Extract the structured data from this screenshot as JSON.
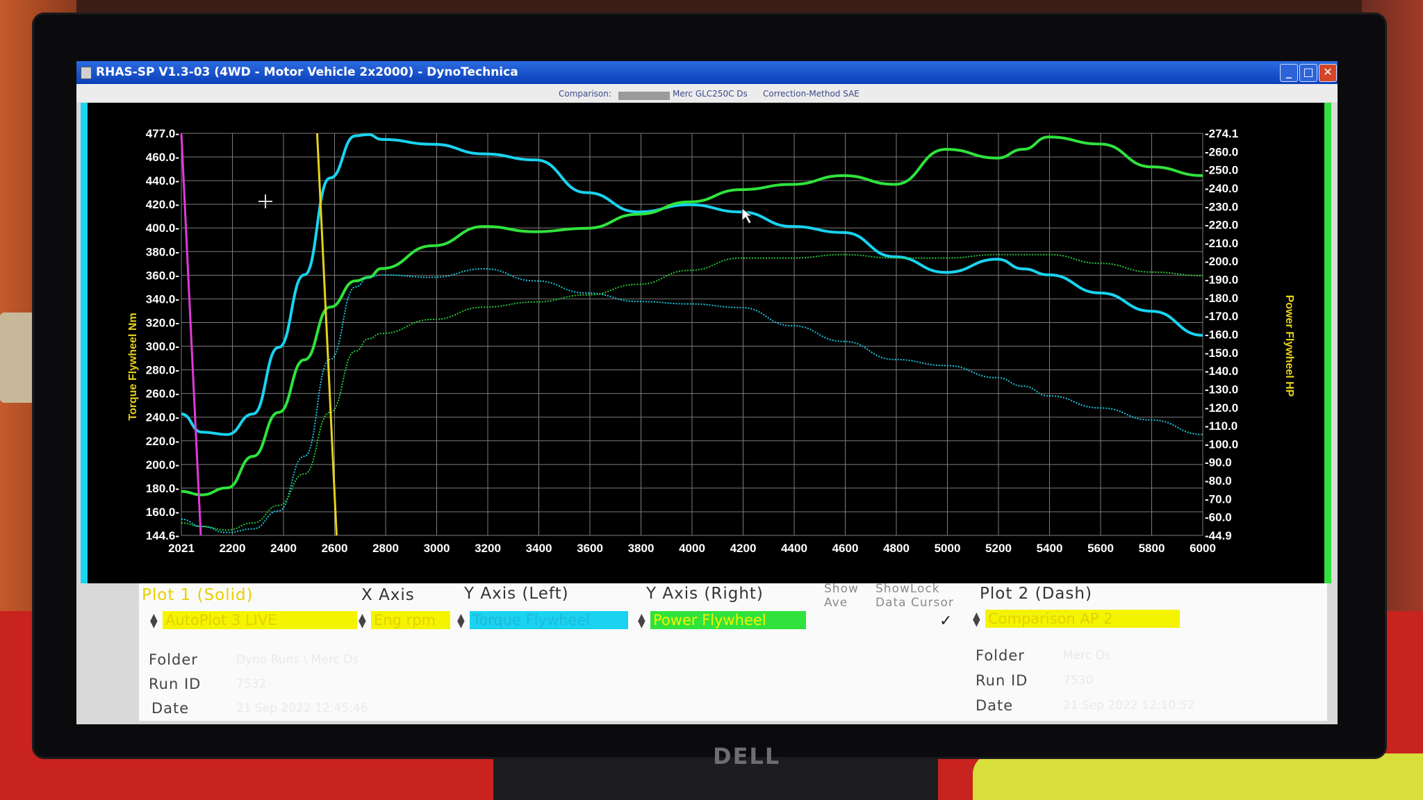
{
  "window": {
    "title": "RHAS-SP V1.3-03  (4WD - Motor Vehicle 2x2000) - DynoTechnica",
    "controls": [
      "_",
      "□",
      "✕"
    ]
  },
  "subheader": {
    "comparison_label": "Comparison:",
    "vehicle": "Merc GLC250C Ds",
    "correction": "Correction-Method  SAE"
  },
  "chart_data": {
    "type": "line",
    "x": [
      2021,
      2100,
      2200,
      2300,
      2400,
      2500,
      2600,
      2700,
      2750,
      2800,
      3000,
      3200,
      3400,
      3600,
      3800,
      4000,
      4200,
      4400,
      4600,
      4800,
      5000,
      5200,
      5300,
      5400,
      5600,
      5800,
      6000
    ],
    "x_ticks": [
      "2021",
      "2200",
      "2400",
      "2600",
      "2800",
      "3000",
      "3200",
      "3400",
      "3600",
      "3800",
      "4000",
      "4200",
      "4400",
      "4600",
      "4800",
      "5000",
      "5200",
      "5400",
      "5600",
      "5800",
      "6000"
    ],
    "y_left_ticks": [
      "477.0-",
      "460.0-",
      "440.0-",
      "420.0-",
      "400.0-",
      "380.0-",
      "360.0-",
      "340.0-",
      "320.0-",
      "300.0-",
      "280.0-",
      "260.0-",
      "240.0-",
      "220.0-",
      "200.0-",
      "180.0-",
      "160.0-",
      "144.6-"
    ],
    "y_right_ticks": [
      "-274.1",
      "-260.0",
      "-250.0",
      "-240.0",
      "-230.0",
      "-220.0",
      "-210.0",
      "-200.0",
      "-190.0",
      "-180.0",
      "-170.0",
      "-160.0",
      "-150.0",
      "-140.0",
      "-130.0",
      "-120.0",
      "-110.0",
      "-100.0",
      "-90.0",
      "-80.0",
      "-70.0",
      "-60.0",
      "-44.9"
    ],
    "ylabel_left": "Torque Flywheel Nm",
    "ylabel_right": "Power Flywheel HP",
    "ylim_left": [
      144.6,
      477.0
    ],
    "ylim_right": [
      44.9,
      274.1
    ],
    "xlim": [
      2021,
      6000
    ],
    "grid": true,
    "series": [
      {
        "name": "Torque Flywheel",
        "style": "solid",
        "axis": "left",
        "color": "#19d3f0",
        "values": [
          245,
          230,
          228,
          245,
          300,
          360,
          440,
          475,
          476,
          472,
          468,
          460,
          455,
          428,
          412,
          418,
          412,
          400,
          395,
          375,
          362,
          373,
          365,
          360,
          345,
          330,
          310
        ]
      },
      {
        "name": "Power Flywheel",
        "style": "solid",
        "axis": "right",
        "color": "#2fe33c",
        "values": [
          70,
          68,
          72,
          90,
          115,
          145,
          175,
          190,
          192,
          197,
          210,
          221,
          218,
          220,
          228,
          235,
          242,
          245,
          250,
          245,
          265,
          260,
          265,
          272,
          268,
          255,
          250
        ]
      },
      {
        "name": "Torque Flywheel",
        "style": "dash",
        "axis": "left",
        "color": "#19c6e0",
        "values": [
          158,
          152,
          147,
          150,
          165,
          210,
          290,
          350,
          358,
          360,
          358,
          365,
          355,
          345,
          338,
          336,
          333,
          318,
          305,
          290,
          285,
          275,
          268,
          260,
          250,
          240,
          228
        ]
      },
      {
        "name": "Power Flywheel",
        "style": "dash",
        "axis": "right",
        "color": "#26c936",
        "values": [
          52,
          50,
          48,
          52,
          62,
          80,
          115,
          150,
          157,
          160,
          168,
          175,
          178,
          182,
          188,
          196,
          203,
          203,
          205,
          203,
          203,
          205,
          205,
          205,
          200,
          195,
          193
        ]
      }
    ],
    "markers": [
      {
        "x": 2021,
        "color": "#e23ad8"
      },
      {
        "x": 2550,
        "color": "#e6d21a"
      }
    ],
    "cursor_at": [
      2200,
      410
    ]
  },
  "panel": {
    "plot1": {
      "label": "Plot 1 (Solid)",
      "value": "AutoPlot 3 LIVE",
      "color": "#f4f400"
    },
    "x_axis": {
      "label": "X Axis",
      "value": "Eng rpm",
      "color": "#f4f400"
    },
    "y_left": {
      "label": "Y Axis (Left)",
      "value": "Torque Flywheel",
      "color": "#19d3f0"
    },
    "y_right": {
      "label": "Y Axis (Right)",
      "value": "Power Flywheel",
      "color": "#2fe33c"
    },
    "show": {
      "line1": "Show",
      "line2": "Ave"
    },
    "showlock": {
      "line1": "ShowLock",
      "line2": "Data Cursor"
    },
    "check": "✓",
    "plot2": {
      "label": "Plot 2 (Dash)",
      "value": "Comparison AP 2",
      "color": "#f4f400"
    },
    "left_fields": {
      "folder_label": "Folder",
      "folder_value": "Dyno Runs \\ Merc Ds",
      "run_label": "Run ID",
      "run_value": "7532",
      "date_label": "Date",
      "date_value": "21 Sep 2022  12:45:46"
    },
    "right_fields": {
      "folder_label": "Folder",
      "folder_value": "Merc  Ds",
      "run_label": "Run ID",
      "run_value": "7530",
      "date_label": "Date",
      "date_value": "21 Sep 2022  12:10:52"
    }
  },
  "monitor": {
    "brand": "DELL"
  }
}
